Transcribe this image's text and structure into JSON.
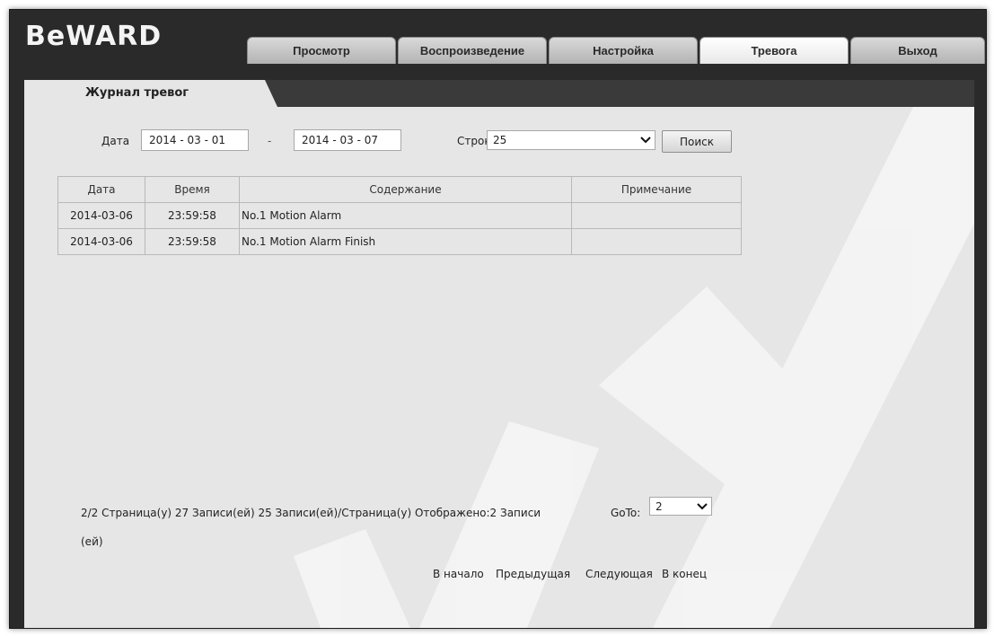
{
  "app": {
    "logo": "BeWARD"
  },
  "tabs": [
    {
      "label": "Просмотр",
      "active": false
    },
    {
      "label": "Воспроизведение",
      "active": false
    },
    {
      "label": "Настройка",
      "active": false
    },
    {
      "label": "Тревога",
      "active": true
    },
    {
      "label": "Выход",
      "active": false
    }
  ],
  "subtab": {
    "label": "Журнал тревог"
  },
  "filter": {
    "date_label": "Дата",
    "date_from": "2014 - 03 - 01",
    "separator": "-",
    "date_to": "2014 - 03 - 07",
    "rows_label": "Строк",
    "rows_value": "25",
    "search_label": "Поиск"
  },
  "table": {
    "headers": [
      "Дата",
      "Время",
      "Содержание",
      "Примечание"
    ],
    "rows": [
      [
        "2014-03-06",
        "23:59:58",
        "No.1 Motion Alarm",
        ""
      ],
      [
        "2014-03-06",
        "23:59:58",
        "No.1 Motion Alarm Finish",
        ""
      ]
    ]
  },
  "pagination": {
    "summary": "2/2 Страница(у) 27 Записи(ей) 25 Записи(ей)/Страница(у) Отображено:2 Записи",
    "summary_wrap": "(ей)",
    "goto_label": "GoTo:",
    "goto_value": "2",
    "first": "В начало",
    "prev": "Предыдущая",
    "next": "Следующая",
    "last": "В конец"
  },
  "colors": {
    "frame": "#2a2a2a",
    "panel": "#e6e6e6",
    "watermark": "#ffffff"
  }
}
